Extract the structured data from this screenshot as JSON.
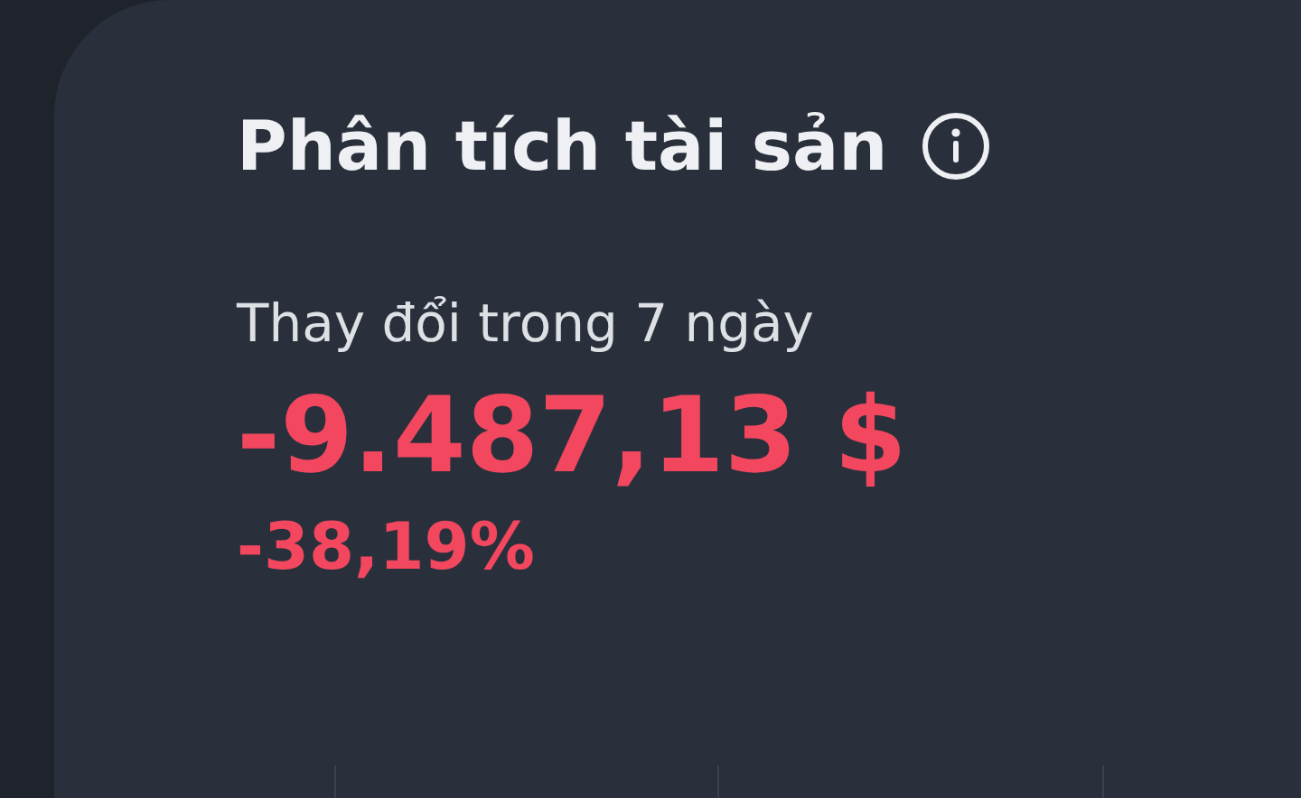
{
  "title": "Phân tích tài sản",
  "change": {
    "label": "Thay đổi trong 7 ngày",
    "amount": "-9.487,13 $",
    "percent": "-38,19%"
  }
}
